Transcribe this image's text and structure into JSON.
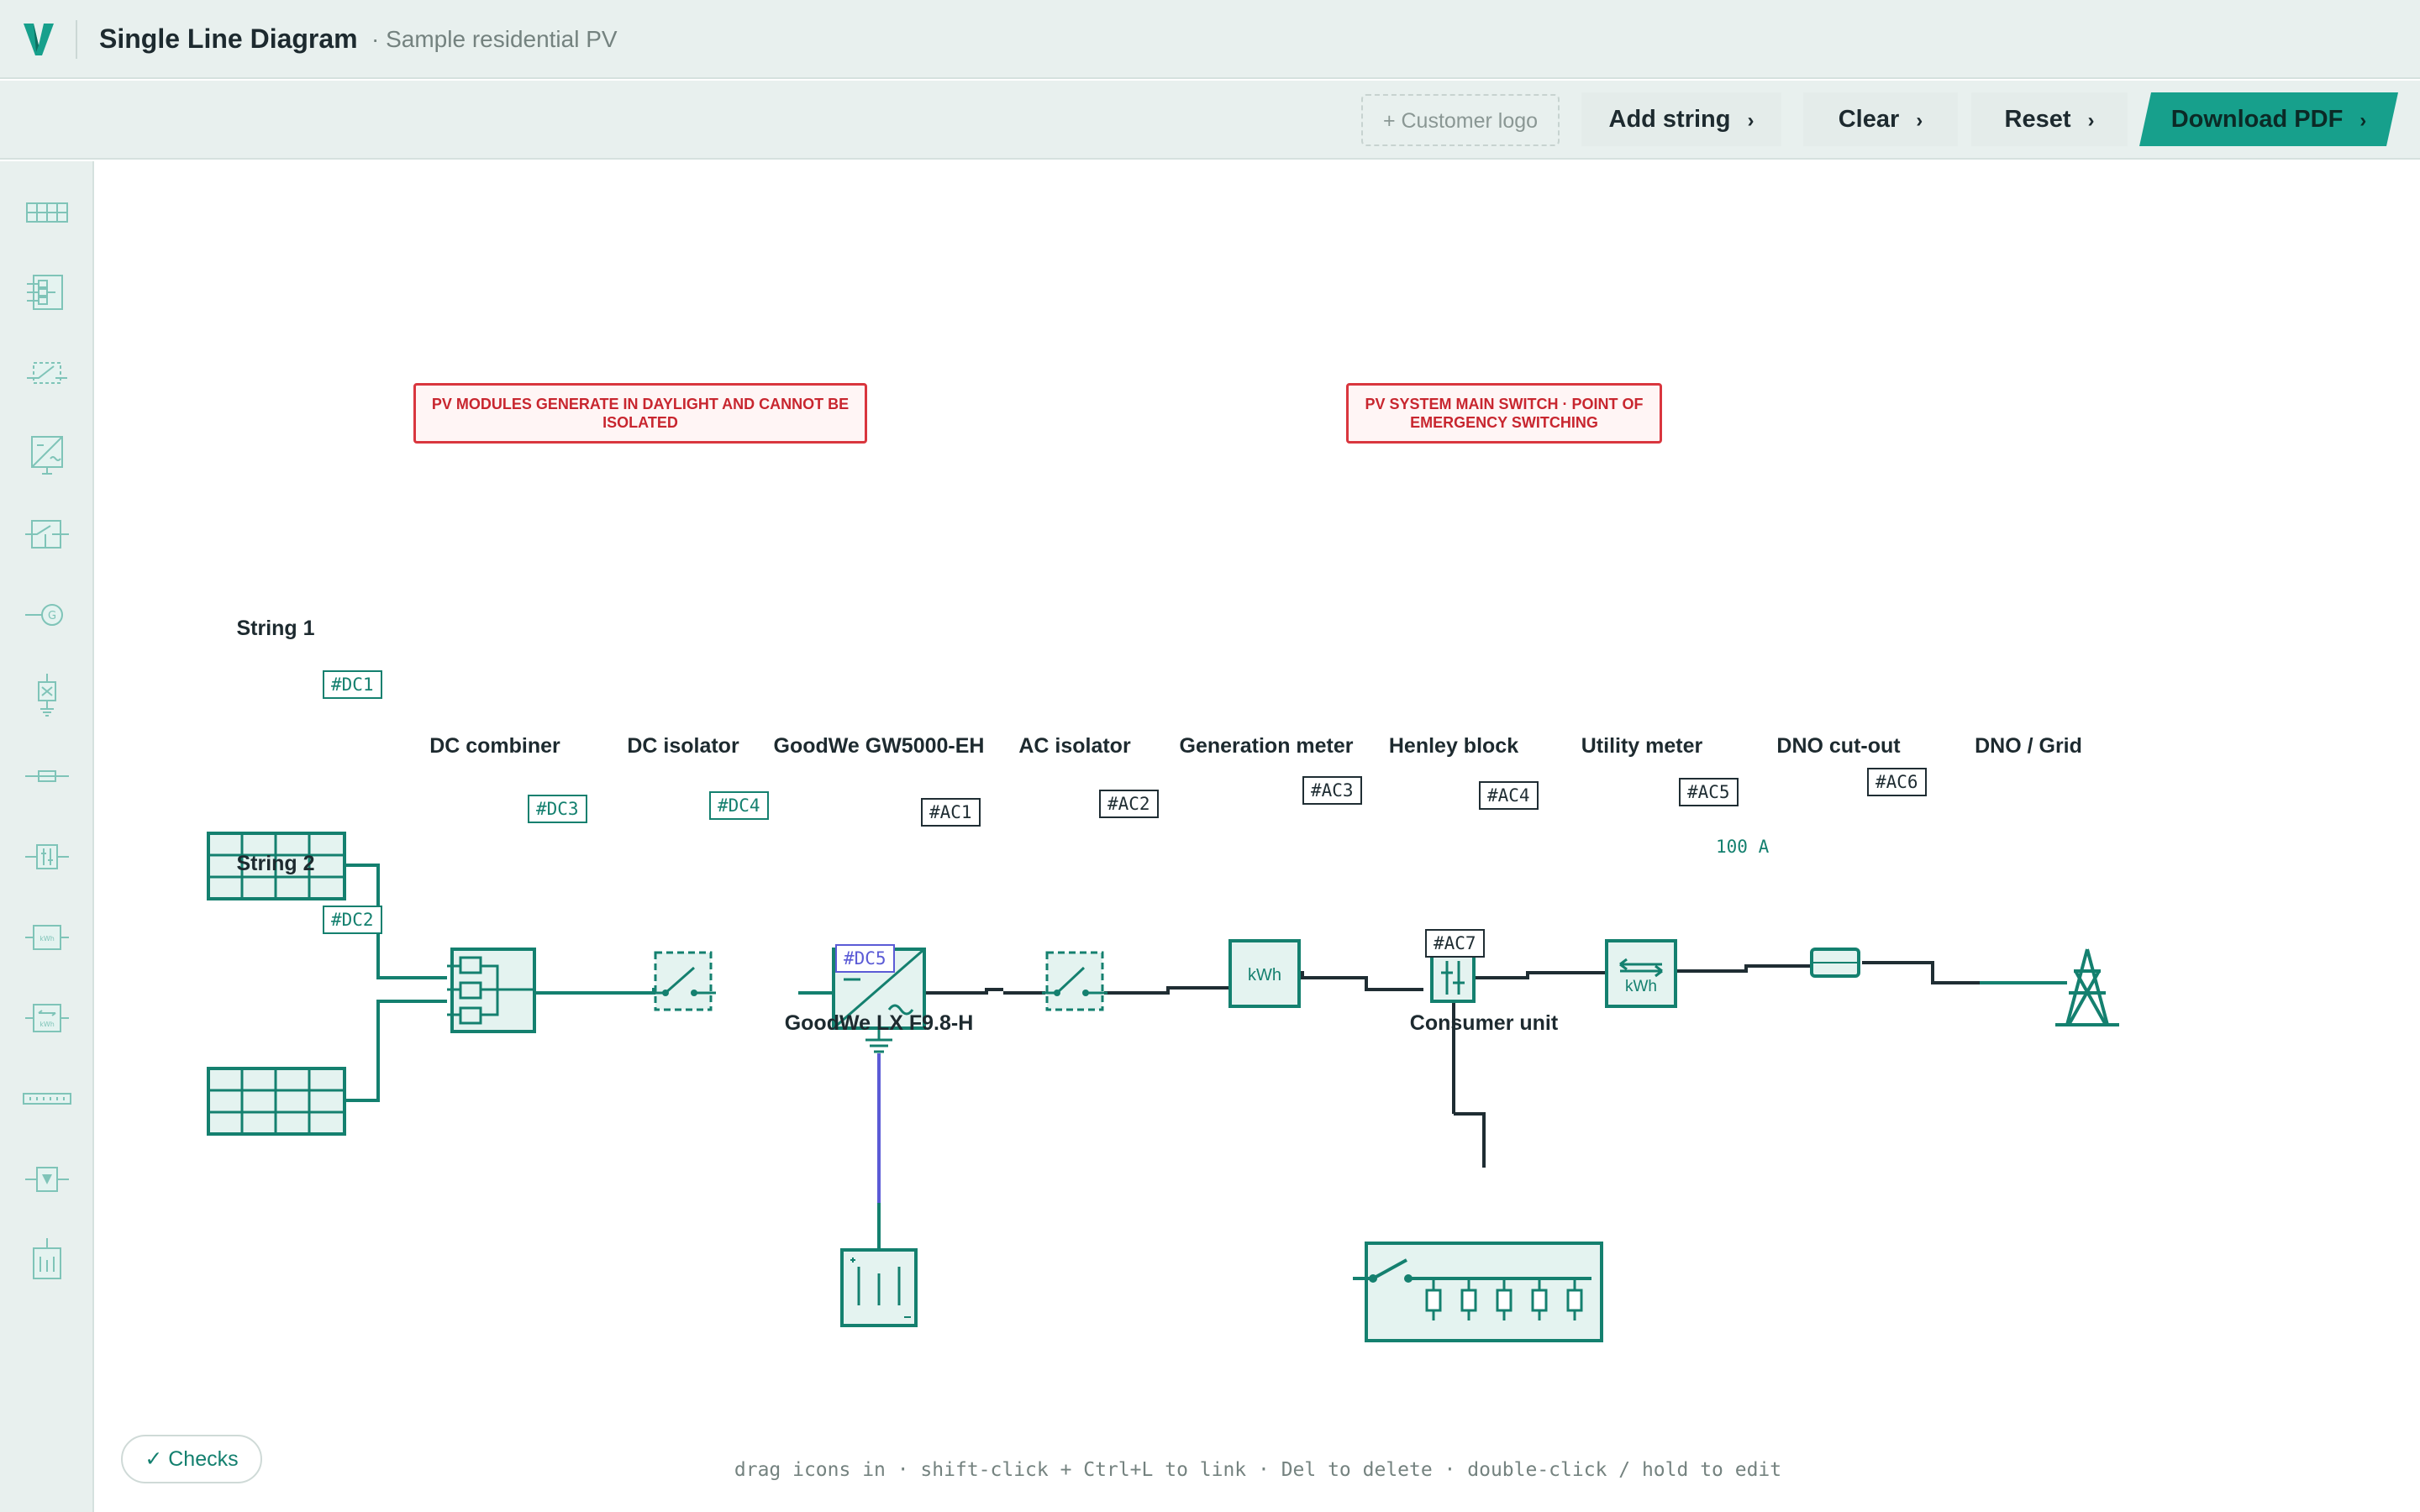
{
  "header": {
    "title": "Single Line Diagram",
    "project": "· Sample residential PV"
  },
  "toolbar": {
    "customer_logo": "+ Customer logo",
    "add_string": "Add string",
    "clear": "Clear",
    "reset": "Reset",
    "download_pdf": "Download PDF",
    "chevron": "›"
  },
  "sidebar": {
    "items": [
      {
        "icon": "pv-array-icon"
      },
      {
        "icon": "dc-combiner-icon"
      },
      {
        "icon": "isolator-icon"
      },
      {
        "icon": "inverter-icon"
      },
      {
        "icon": "ac-isolator-icon"
      },
      {
        "icon": "generator-icon"
      },
      {
        "icon": "spd-icon"
      },
      {
        "icon": "fuse-icon"
      },
      {
        "icon": "henley-block-icon"
      },
      {
        "icon": "meter-icon"
      },
      {
        "icon": "utility-meter-icon"
      },
      {
        "icon": "busbar-icon"
      },
      {
        "icon": "rcd-icon"
      },
      {
        "icon": "battery-icon"
      }
    ]
  },
  "warnings": {
    "pv_modules": "PV MODULES GENERATE IN DAYLIGHT AND CANNOT BE ISOLATED",
    "main_switch": "PV SYSTEM MAIN SWITCH · POINT OF EMERGENCY SWITCHING"
  },
  "components": {
    "string1": "String 1",
    "string2": "String 2",
    "dc_combiner": "DC combiner",
    "dc_isolator": "DC isolator",
    "inverter": "GoodWe GW5000-EH",
    "ac_isolator": "AC isolator",
    "gen_meter": "Generation meter",
    "henley": "Henley block",
    "utility_meter": "Utility meter",
    "dno_cutout": "DNO cut-out",
    "grid": "DNO / Grid",
    "battery": "GoodWe LX F9.8-H",
    "consumer_unit": "Consumer unit"
  },
  "symbols": {
    "kwh": "kWh"
  },
  "cables": {
    "dc1": "#DC1",
    "dc2": "#DC2",
    "dc3": "#DC3",
    "dc4": "#DC4",
    "dc5": "#DC5",
    "ac1": "#AC1",
    "ac2": "#AC2",
    "ac3": "#AC3",
    "ac4": "#AC4",
    "ac5": "#AC5",
    "ac6": "#AC6",
    "ac7": "#AC7"
  },
  "fuse_rating": "100 A",
  "checks": "✓ Checks",
  "hint": "drag icons in · shift-click + Ctrl+L to link · Del to delete · double-click / hold to edit",
  "colors": {
    "accent": "#17a08c",
    "line_dc": "#14806f",
    "line_ac": "#1f2d33",
    "line_battery": "#5b5bd6",
    "warning": "#d9363e"
  }
}
